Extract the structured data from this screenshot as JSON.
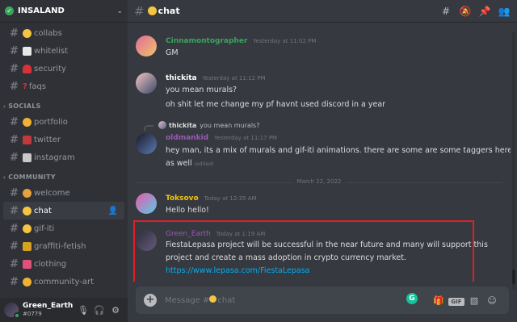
{
  "server": {
    "name": "INSALAND",
    "check_icon": "✓",
    "chevron": "⌄"
  },
  "sidebar": {
    "channels_top": [
      {
        "name": "collabs",
        "emoji_color": "#f5c542"
      },
      {
        "name": "whitelist",
        "emoji_color": "#e8e8e8"
      },
      {
        "name": "security",
        "emoji_color": "#d6323a"
      },
      {
        "name": "faqs",
        "emoji_color": "#d6323a",
        "emoji_text": "?"
      }
    ],
    "categories": [
      {
        "name": "SOCIALS",
        "channels": [
          {
            "name": "portfolio",
            "emoji_color": "#f0b232"
          },
          {
            "name": "twitter",
            "emoji_color": "#c0393b"
          },
          {
            "name": "instagram",
            "emoji_color": "#c9c9c9"
          }
        ]
      },
      {
        "name": "COMMUNITY",
        "channels": [
          {
            "name": "welcome",
            "emoji_color": "#e6a23c"
          },
          {
            "name": "chat",
            "emoji_color": "#f5c542",
            "active": true
          },
          {
            "name": "gif-iti",
            "emoji_color": "#f5c542"
          },
          {
            "name": "graffiti-fetish",
            "emoji_color": "#d6a020"
          },
          {
            "name": "clothing",
            "emoji_color": "#e0507a"
          },
          {
            "name": "community-art",
            "emoji_color": "#f0b232"
          }
        ]
      }
    ]
  },
  "user": {
    "name": "Green_Earth",
    "tag": "#0779"
  },
  "channel_header": {
    "name": "chat",
    "emoji_color": "#f5c542"
  },
  "messages": [
    {
      "author": "Cinnamontographer",
      "author_color": "#3ba55d",
      "time": "Yesterday at 11:02 PM",
      "lines": [
        "GM"
      ]
    },
    {
      "author": "thickita",
      "author_color": "#ffffff",
      "time": "Yesterday at 11:12 PM",
      "lines": [
        "you mean murals?",
        "oh shit let me change my pf havnt used discord in a year"
      ]
    },
    {
      "reply_author": "thickita",
      "reply_text": "you mean murals?",
      "author": "oldmankid",
      "author_color": "#9b59b6",
      "time": "Yesterday at 11:17 PM",
      "lines": [
        "hey man, its a mix of murals and gif-iti animations. there are some are some taggers here",
        "as well"
      ],
      "edited": "(edited)"
    },
    {
      "author": "Toksovo",
      "author_color": "#f1c40f",
      "time": "Today at 12:35 AM",
      "lines": [
        "Hello hello!"
      ]
    },
    {
      "author": "Green_Earth",
      "author_color": "#9b59b6",
      "time": "Today at 1:19 AM",
      "lines": [
        "FiestaLepasa project will be successful in the near future and many will support this",
        "project and create a mass adoption in crypto currency market."
      ],
      "link": "https://www.lepasa.com/FiestaLepasa"
    }
  ],
  "date_divider": "March 22, 2022",
  "composer": {
    "placeholder": "Message #",
    "channel": "chat"
  }
}
